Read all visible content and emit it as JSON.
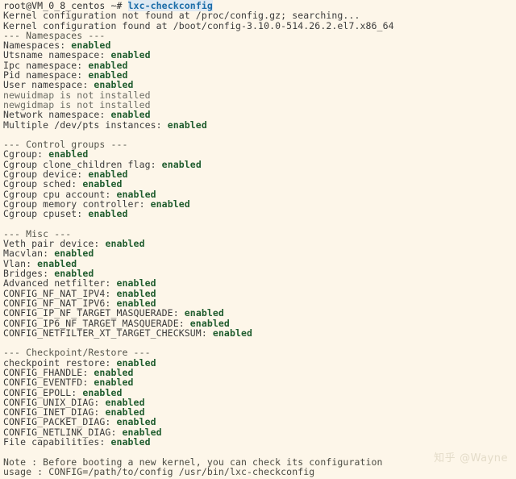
{
  "terminal": {
    "background_color": "#fdf6e9",
    "foreground_color": "#3b3b3b",
    "enabled_color": "#1f5c2e",
    "command_color": "#1b6ca8",
    "prompt": {
      "user_host": "root@VM_0_8_centos",
      "path": "~",
      "symbol": "#",
      "full": "root@VM_0_8_centos ~# ",
      "command": "lxc-checkconfig"
    },
    "lines": [
      {
        "type": "prompt",
        "prompt": "root@VM_0_8_centos ~# ",
        "command": "lxc-checkconfig"
      },
      {
        "type": "plain",
        "text": "Kernel configuration not found at /proc/config.gz; searching..."
      },
      {
        "type": "plain",
        "text": "Kernel configuration found at /boot/config-3.10.0-514.26.2.el7.x86_64"
      },
      {
        "type": "section",
        "text": "--- Namespaces ---"
      },
      {
        "type": "kv",
        "label": "Namespaces: ",
        "value": "enabled"
      },
      {
        "type": "kv",
        "label": "Utsname namespace: ",
        "value": "enabled"
      },
      {
        "type": "kv",
        "label": "Ipc namespace: ",
        "value": "enabled"
      },
      {
        "type": "kv",
        "label": "Pid namespace: ",
        "value": "enabled"
      },
      {
        "type": "kv",
        "label": "User namespace: ",
        "value": "enabled"
      },
      {
        "type": "dim",
        "text": "newuidmap is not installed"
      },
      {
        "type": "dim",
        "text": "newgidmap is not installed"
      },
      {
        "type": "kv",
        "label": "Network namespace: ",
        "value": "enabled"
      },
      {
        "type": "kv",
        "label": "Multiple /dev/pts instances: ",
        "value": "enabled"
      },
      {
        "type": "blank",
        "text": ""
      },
      {
        "type": "section",
        "text": "--- Control groups ---"
      },
      {
        "type": "kv",
        "label": "Cgroup: ",
        "value": "enabled"
      },
      {
        "type": "kv",
        "label": "Cgroup clone_children flag: ",
        "value": "enabled"
      },
      {
        "type": "kv",
        "label": "Cgroup device: ",
        "value": "enabled"
      },
      {
        "type": "kv",
        "label": "Cgroup sched: ",
        "value": "enabled"
      },
      {
        "type": "kv",
        "label": "Cgroup cpu account: ",
        "value": "enabled"
      },
      {
        "type": "kv",
        "label": "Cgroup memory controller: ",
        "value": "enabled"
      },
      {
        "type": "kv",
        "label": "Cgroup cpuset: ",
        "value": "enabled"
      },
      {
        "type": "blank",
        "text": ""
      },
      {
        "type": "section",
        "text": "--- Misc ---"
      },
      {
        "type": "kv",
        "label": "Veth pair device: ",
        "value": "enabled"
      },
      {
        "type": "kv",
        "label": "Macvlan: ",
        "value": "enabled"
      },
      {
        "type": "kv",
        "label": "Vlan: ",
        "value": "enabled"
      },
      {
        "type": "kv",
        "label": "Bridges: ",
        "value": "enabled"
      },
      {
        "type": "kv",
        "label": "Advanced netfilter: ",
        "value": "enabled"
      },
      {
        "type": "kv",
        "label": "CONFIG_NF_NAT_IPV4: ",
        "value": "enabled"
      },
      {
        "type": "kv",
        "label": "CONFIG_NF_NAT_IPV6: ",
        "value": "enabled"
      },
      {
        "type": "kv",
        "label": "CONFIG_IP_NF_TARGET_MASQUERADE: ",
        "value": "enabled"
      },
      {
        "type": "kv",
        "label": "CONFIG_IP6_NF_TARGET_MASQUERADE: ",
        "value": "enabled"
      },
      {
        "type": "kv",
        "label": "CONFIG_NETFILTER_XT_TARGET_CHECKSUM: ",
        "value": "enabled"
      },
      {
        "type": "blank",
        "text": ""
      },
      {
        "type": "section",
        "text": "--- Checkpoint/Restore ---"
      },
      {
        "type": "kv",
        "label": "checkpoint restore: ",
        "value": "enabled"
      },
      {
        "type": "kv",
        "label": "CONFIG_FHANDLE: ",
        "value": "enabled"
      },
      {
        "type": "kv",
        "label": "CONFIG_EVENTFD: ",
        "value": "enabled"
      },
      {
        "type": "kv",
        "label": "CONFIG_EPOLL: ",
        "value": "enabled"
      },
      {
        "type": "kv",
        "label": "CONFIG_UNIX_DIAG: ",
        "value": "enabled"
      },
      {
        "type": "kv",
        "label": "CONFIG_INET_DIAG: ",
        "value": "enabled"
      },
      {
        "type": "kv",
        "label": "CONFIG_PACKET_DIAG: ",
        "value": "enabled"
      },
      {
        "type": "kv",
        "label": "CONFIG_NETLINK_DIAG: ",
        "value": "enabled"
      },
      {
        "type": "kv",
        "label": "File capabilities: ",
        "value": "enabled"
      },
      {
        "type": "blank",
        "text": ""
      },
      {
        "type": "note",
        "text": "Note : Before booting a new kernel, you can check its configuration"
      },
      {
        "type": "note",
        "text": "usage : CONFIG=/path/to/config /usr/bin/lxc-checkconfig"
      }
    ]
  },
  "watermark": {
    "logo": "知乎",
    "handle": "@Wayne"
  }
}
